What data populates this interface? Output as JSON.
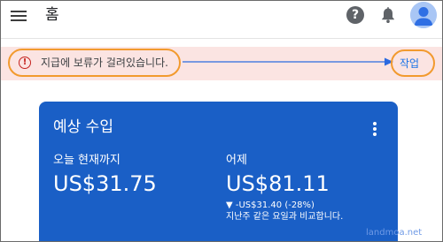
{
  "appbar": {
    "title": "홈",
    "help_label": "?"
  },
  "alert": {
    "icon_label": "!",
    "message": "지급에 보류가 걸려있습니다.",
    "action_label": "작업"
  },
  "card": {
    "title": "예상 수입",
    "today": {
      "label": "오늘 현재까지",
      "value": "US$31.75"
    },
    "yesterday": {
      "label": "어제",
      "value": "US$81.11",
      "change": "▼ -US$31.40 (-28%)",
      "comparison": "지난주 같은 요일과 비교합니다."
    }
  },
  "watermark": "landmoa.net",
  "colors": {
    "card": "#1a5fc6",
    "alert_bg": "#fbe4e2",
    "alert_icon": "#c5221f",
    "annotation": "#f29a2e",
    "action_link": "#1a73e8"
  },
  "icons": [
    "menu-icon",
    "help-icon",
    "bell-icon",
    "avatar-icon",
    "error-icon",
    "more-vert-icon"
  ]
}
